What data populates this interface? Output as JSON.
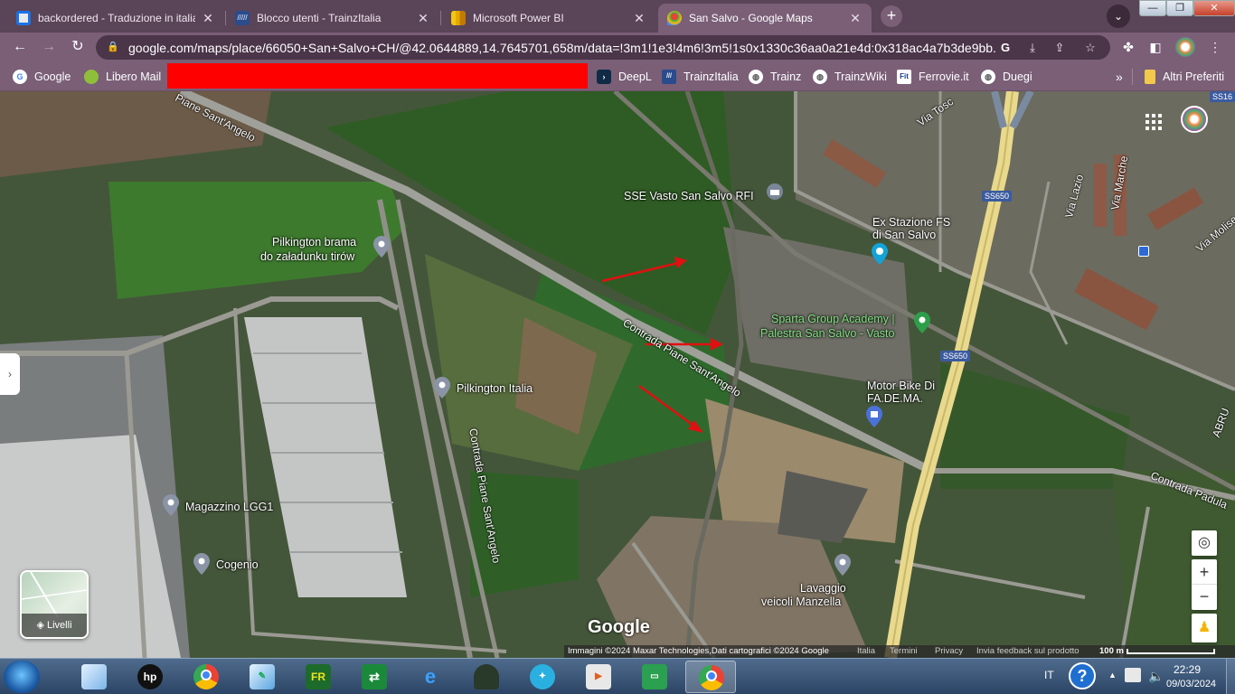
{
  "browser": {
    "tabs": [
      {
        "title": "backordered - Traduzione in italia",
        "favicon": "translate-icon",
        "color": "#e8eaed"
      },
      {
        "title": "Blocco utenti - TrainzItalia",
        "favicon": "trainzitalia-icon",
        "color": "#2b4c8c"
      },
      {
        "title": "Microsoft Power BI",
        "favicon": "powerbi-icon",
        "color": "#f2c811"
      },
      {
        "title": "San Salvo - Google Maps",
        "favicon": "maps-icon",
        "color": "#34a853"
      }
    ],
    "new_tab": "+",
    "url": "google.com/maps/place/66050+San+Salvo+CH/@42.0644889,14.7645701,658m/data=!3m1!1e3!4m6!3m5!1s0x1330c36aa0a21e4d:0x318ac4a7b3de9bb...",
    "bookmarks": [
      "Google",
      "Libero Mail",
      "DeepL",
      "TrainzItalia",
      "Trainz",
      "TrainzWiki",
      "Ferrovie.it",
      "Duegi"
    ],
    "more_bookmarks": "»",
    "other_bookmarks": "Altri Preferiti"
  },
  "map": {
    "labels": {
      "sse": "SSE Vasto San Salvo RFI",
      "station_1": "Ex Stazione FS",
      "station_2": "di San Salvo",
      "pilkington_brama_1": "Pilkington brama",
      "pilkington_brama_2": "do załadunku tirów",
      "sparta_1": "Sparta Group Academy |",
      "sparta_2": "Palestra San Salvo - Vasto",
      "motorbike_1": "Motor Bike Di",
      "motorbike_2": "FA.DE.MA.",
      "pilkington_italia": "Pilkington Italia",
      "magazzino": "Magazzino LGG1",
      "cogenio": "Cogenio",
      "lavaggio_1": "Lavaggio",
      "lavaggio_2": "veicoli Manzella"
    },
    "roads": {
      "sant_angelo_top": "Piane Sant'Angelo",
      "contrada_piane": "Contrada Piane Sant'Angelo",
      "contrada_vertical": "Contrada Piane Sant'Angelo",
      "via_tosc": "Via Tosc",
      "via_lazio": "Via Lazio",
      "via_marche": "Via Marche",
      "via_molise": "Via Molise",
      "contrada_padula": "Contrada Padula",
      "abruzzo": "ABRU",
      "ss650_a": "SS650",
      "ss650_b": "SS650",
      "ss16": "SS16"
    },
    "layers_label": "Livelli",
    "google_logo": "Google",
    "attribution": {
      "imagery": "Immagini ©2024 Maxar Technologies,Dati cartografici ©2024 Google",
      "country": "Italia",
      "terms": "Termini",
      "privacy": "Privacy",
      "feedback": "Invia feedback sul prodotto",
      "scale": "100 m"
    },
    "zoom_in": "+",
    "zoom_out": "−"
  },
  "taskbar": {
    "language": "IT",
    "time": "22:29",
    "date": "09/03/2024"
  }
}
